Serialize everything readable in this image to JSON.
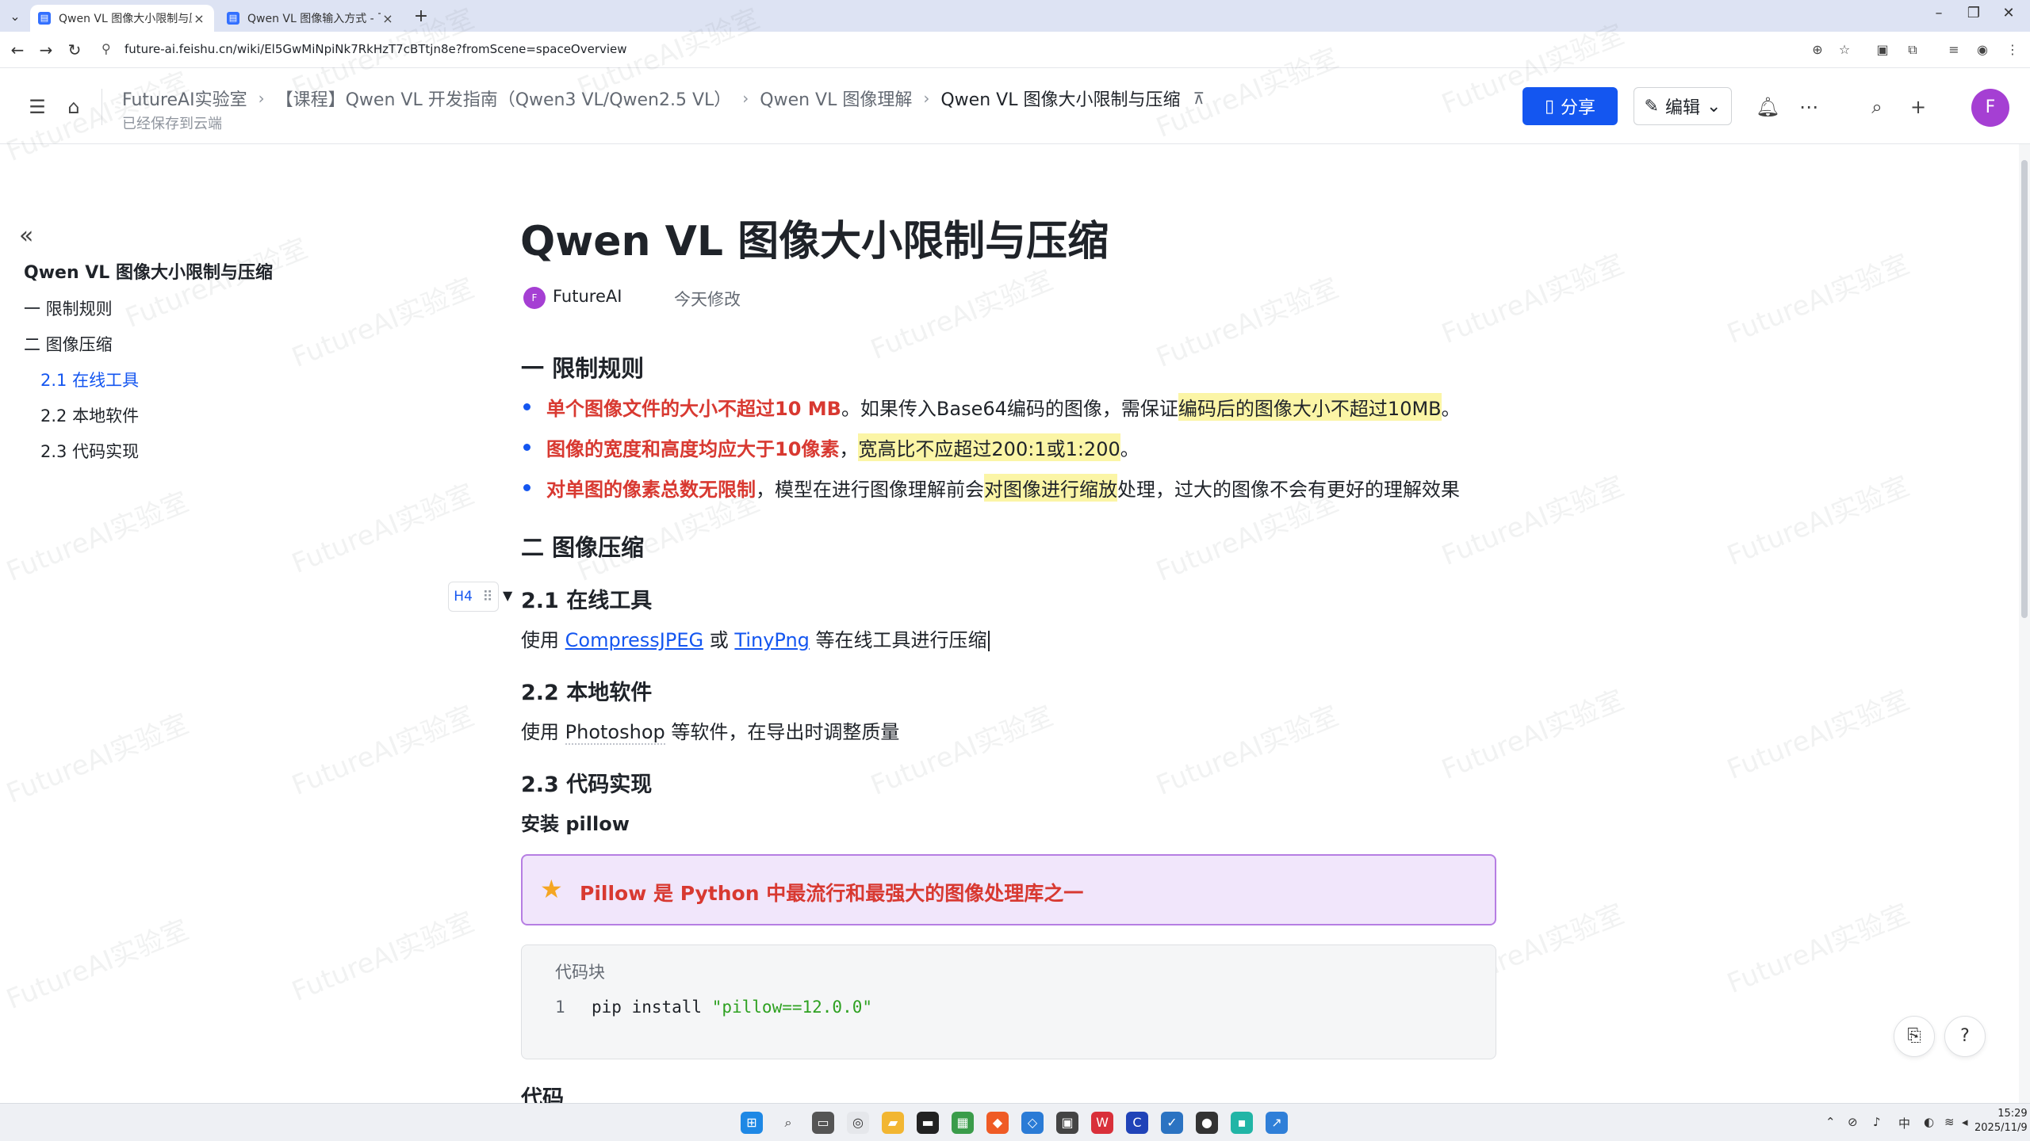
{
  "browser": {
    "tabs": [
      {
        "title": "Qwen VL 图像大小限制与压缩",
        "active": true
      },
      {
        "title": "Qwen VL 图像输入方式 - 飞书",
        "active": false
      }
    ],
    "url": "future-ai.feishu.cn/wiki/El5GwMiNpiNk7RkHzT7cBTtjn8e?fromScene=spaceOverview"
  },
  "header": {
    "breadcrumbs": [
      "FutureAI实验室",
      "【课程】Qwen VL 开发指南（Qwen3 VL/Qwen2.5 VL）",
      "Qwen VL 图像理解",
      "Qwen VL 图像大小限制与压缩"
    ],
    "saved_status": "已经保存到云端",
    "share_label": "分享",
    "edit_label": "编辑",
    "avatar_initial": "F"
  },
  "outline": {
    "title": "Qwen VL 图像大小限制与压缩",
    "items": [
      {
        "label": "一 限制规则",
        "level": 1
      },
      {
        "label": "二 图像压缩",
        "level": 1
      },
      {
        "label": "2.1 在线工具",
        "level": 2,
        "active": true
      },
      {
        "label": "2.2 本地软件",
        "level": 2
      },
      {
        "label": "2.3 代码实现",
        "level": 2
      }
    ]
  },
  "doc": {
    "title": "Qwen VL 图像大小限制与压缩",
    "author": "FutureAI",
    "author_initial": "F",
    "modified": "今天修改",
    "section1": {
      "heading": "一 限制规则",
      "bullets": [
        {
          "red": "单个图像文件的大小不超过10 MB",
          "plain": "。如果传入Base64编码的图像，需保证",
          "hl": "编码后的图像大小不超过10MB",
          "end": "。"
        },
        {
          "red": "图像的宽度和高度均应大于10像素",
          "plain": "，",
          "hl": "宽高比不应超过200:1或1:200",
          "end": "。"
        },
        {
          "red": "对单图的像素总数无限制",
          "plain": "，模型在进行图像理解前会",
          "hl": "对图像进行缩放",
          "end": "处理，过大的图像不会有更好的理解效果"
        }
      ]
    },
    "section2": {
      "heading": "二 图像压缩",
      "sub1": {
        "heading": "2.1 在线工具",
        "handle": "H4",
        "text_a": "使用 ",
        "link1": "CompressJPEG",
        "text_b": " 或 ",
        "link2": "TinyPng",
        "text_c": " 等在线工具进行压缩"
      },
      "sub2": {
        "heading": "2.2 本地软件",
        "text_a": "使用 ",
        "term": "Photoshop",
        "text_b": " 等软件，在导出时调整质量"
      },
      "sub3": {
        "heading": "2.3 代码实现",
        "subheading": "安装 pillow",
        "callout_icon": "star-icon",
        "callout": "Pillow 是 Python 中最流行和最强大的图像处理库之一",
        "code_label": "代码块",
        "code_line_no": "1",
        "code_cmd": "pip install ",
        "code_str": "\"pillow==12.0.0\"",
        "next_heading": "代码"
      }
    },
    "watermark": "FutureAI实验室"
  },
  "taskbar": {
    "time": "15:29",
    "date": "2025/11/9",
    "ime": "中"
  },
  "colors": {
    "accent": "#1456f0",
    "red": "#d83931",
    "highlight": "#fbf5a6",
    "callout_border": "#b67ee3",
    "callout_bg": "#f1e6fb",
    "avatar": "#a53fd3"
  }
}
